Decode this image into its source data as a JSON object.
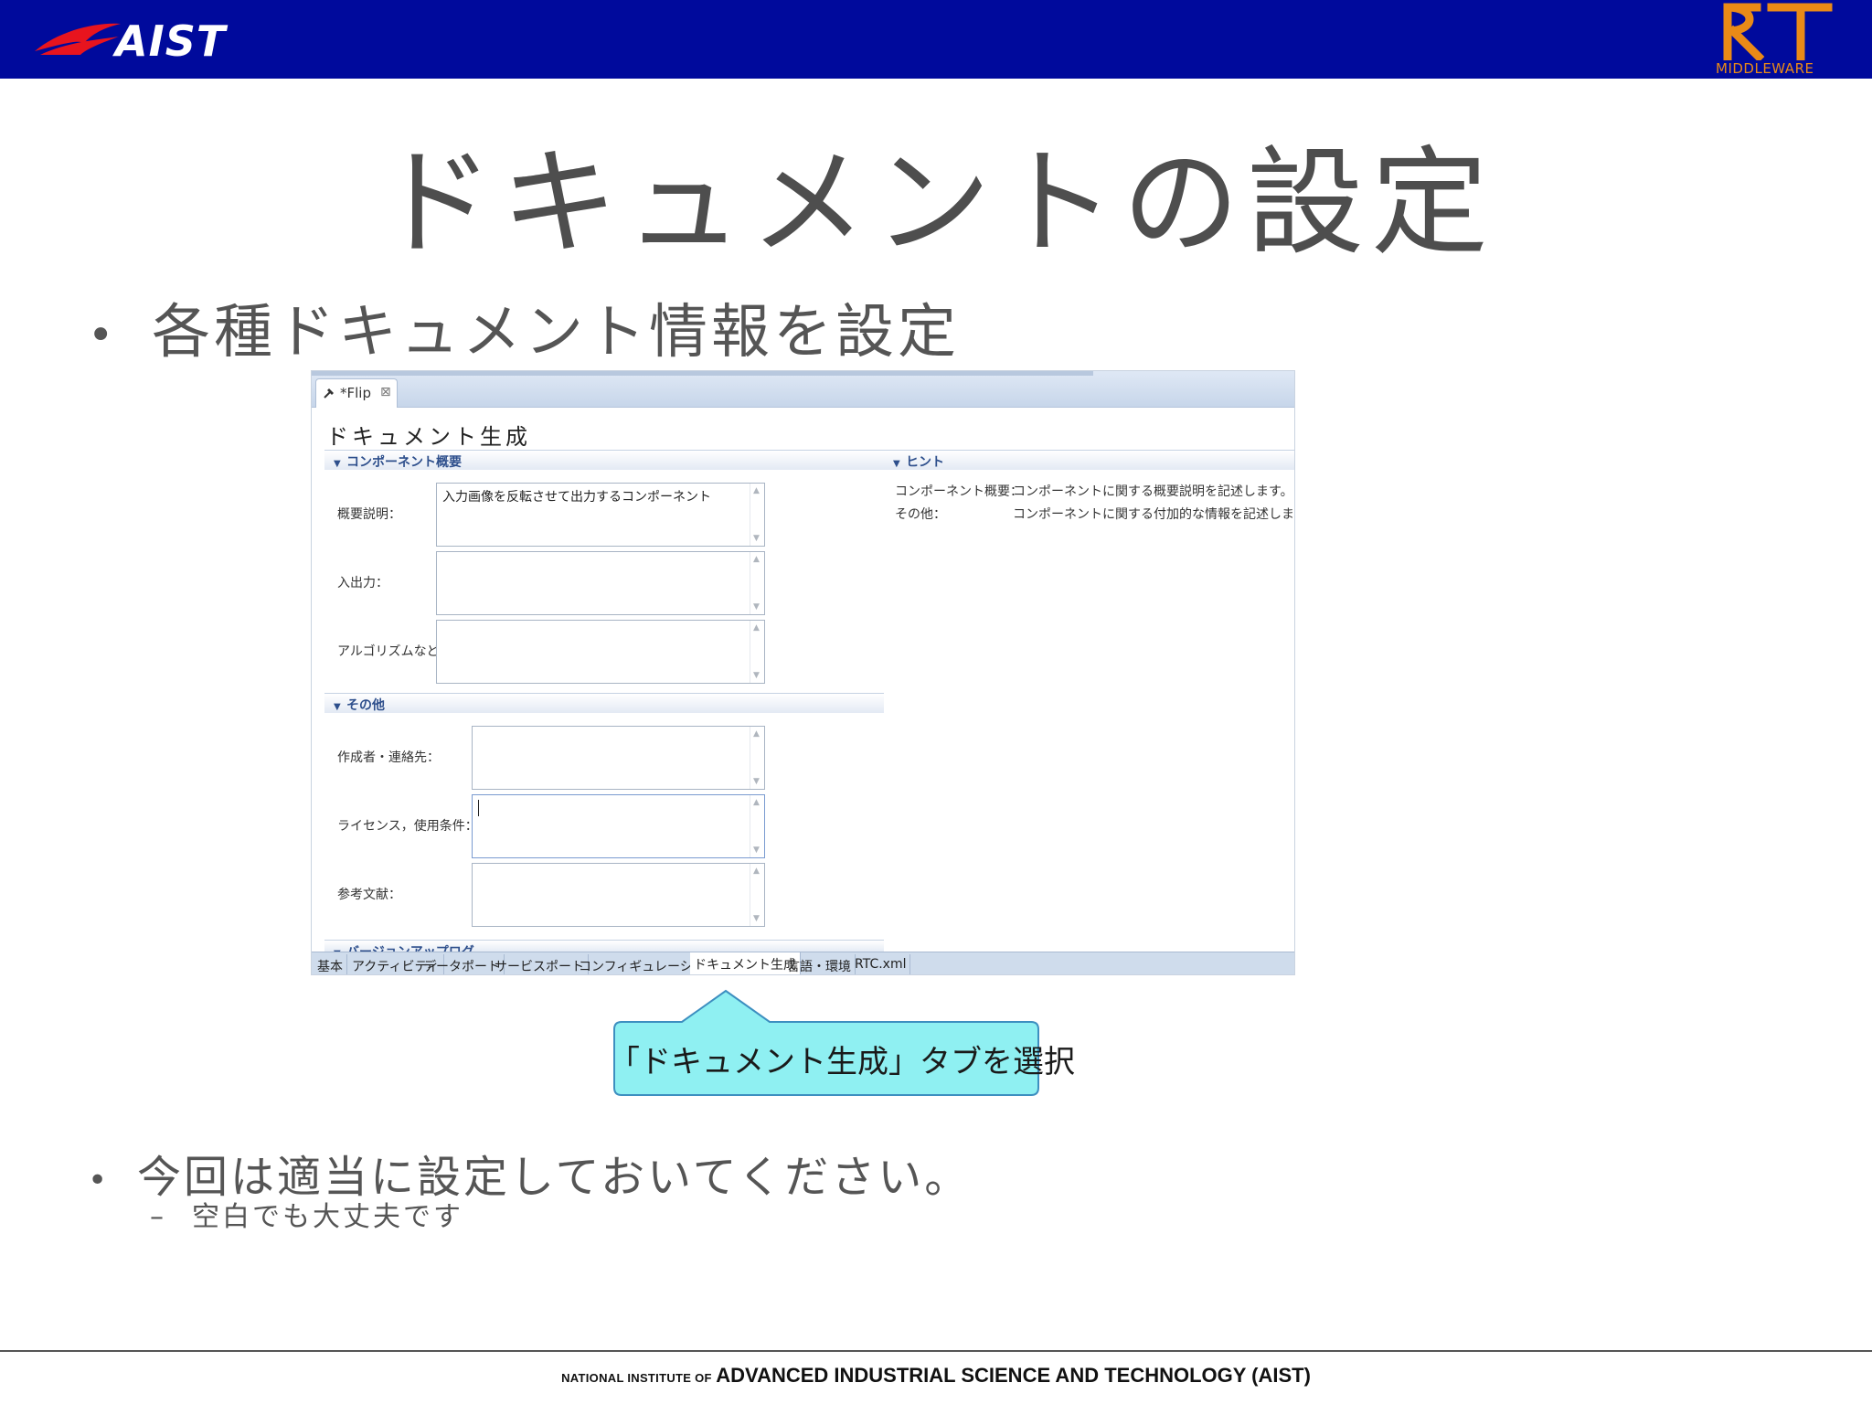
{
  "header": {
    "left_logo_text": "AIST",
    "right_logo_text": "MIDDLEWARE",
    "bar_color": "#000a9c",
    "accent_color": "#e98a17"
  },
  "slide": {
    "title": "ドキュメントの設定",
    "bullet1": "各種ドキュメント情報を設定",
    "bullet_symbol": "•",
    "bullet2": "今回は適当に設定しておいてください。",
    "sub_dash": "–",
    "sub_bullet": "空白でも大丈夫です"
  },
  "editor": {
    "tab_label": "*Flip",
    "tab_close": "⊠",
    "tab_icon": "hammer-icon",
    "page_heading": "ドキュメント生成",
    "section_overview": "コンポーネント概要",
    "section_other": "その他",
    "section_hint": "ヒント",
    "section_version": "バージョンアップログ",
    "fields": {
      "description_label": "概要説明：",
      "description_value": "入力画像を反転させて出力するコンポーネント",
      "io_label": "入出力：",
      "algorithm_label": "アルゴリズムなど：",
      "author_label": "作成者・連絡先：",
      "license_label": "ライセンス，使用条件：",
      "reference_label": "参考文献："
    },
    "hint": {
      "key1": "コンポーネント概要：",
      "val1": "コンポーネントに関する概要説明を記述します。",
      "key2": "その他：",
      "val2": "コンポーネントに関する付加的な情報を記述します。"
    },
    "bottom_tabs": [
      "基本",
      "アクティビティ",
      "データポート",
      "サービスポート",
      "コンフィギュレーション",
      "ドキュメント生成",
      "言語・環境",
      "RTC.xml"
    ],
    "active_tab": "ドキュメント生成"
  },
  "callout": {
    "text": "「ドキュメント生成」タブを選択",
    "fill_color": "#8ff0f2"
  },
  "footer": {
    "small_text": "NATIONAL INSTITUTE OF",
    "big_text": "ADVANCED INDUSTRIAL SCIENCE AND TECHNOLOGY (AIST)"
  }
}
